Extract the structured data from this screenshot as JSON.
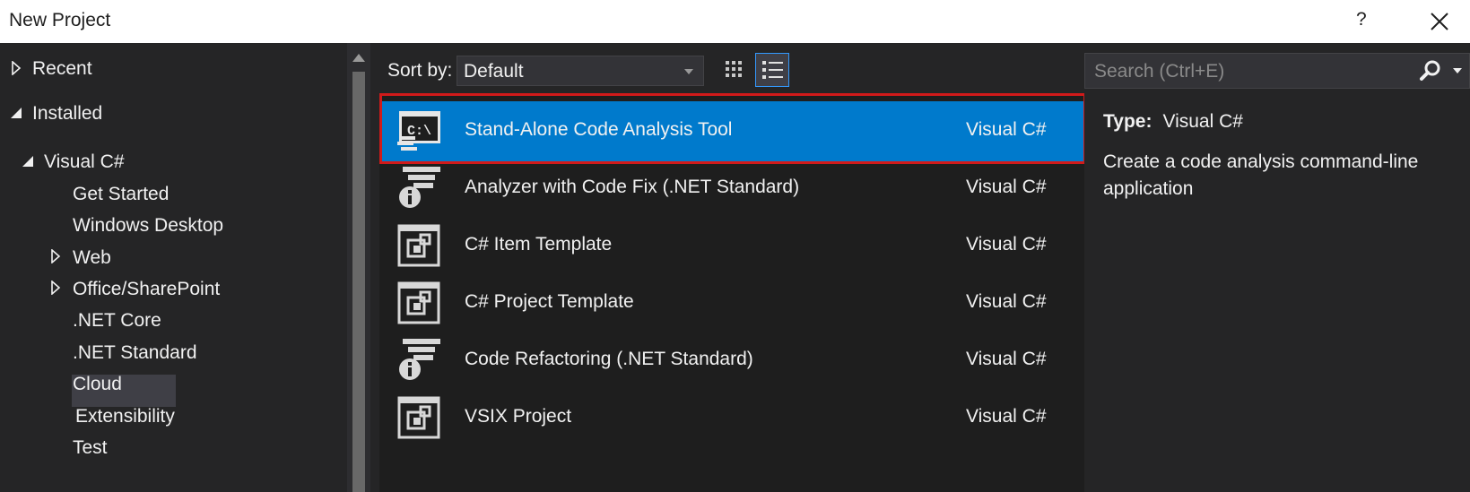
{
  "window": {
    "title": "New Project",
    "help_label": "?"
  },
  "tree": [
    {
      "label": "Recent",
      "indicator": "collapsed"
    },
    {
      "label": "Installed",
      "indicator": "expanded"
    },
    {
      "label": "Visual C#",
      "indicator": "expanded"
    },
    {
      "label": "Get Started",
      "indicator": "none"
    },
    {
      "label": "Windows Desktop",
      "indicator": "none"
    },
    {
      "label": "Web",
      "indicator": "collapsed"
    },
    {
      "label": "Office/SharePoint",
      "indicator": "collapsed"
    },
    {
      "label": ".NET Core",
      "indicator": "none"
    },
    {
      "label": ".NET Standard",
      "indicator": "none"
    },
    {
      "label": "Cloud",
      "indicator": "none"
    },
    {
      "label": "Extensibility",
      "indicator": "none",
      "selected": true
    },
    {
      "label": "Test",
      "indicator": "none"
    }
  ],
  "toolbar": {
    "sort_label": "Sort by:",
    "sort_value": "Default"
  },
  "templates": [
    {
      "name": "Stand-Alone Code Analysis Tool",
      "language": "Visual C#",
      "icon": "console-app-icon",
      "selected": true
    },
    {
      "name": "Analyzer with Code Fix (.NET Standard)",
      "language": "Visual C#",
      "icon": "analyzer-info-icon"
    },
    {
      "name": "C# Item Template",
      "language": "Visual C#",
      "icon": "template-icon"
    },
    {
      "name": "C# Project Template",
      "language": "Visual C#",
      "icon": "template-icon"
    },
    {
      "name": "Code Refactoring (.NET Standard)",
      "language": "Visual C#",
      "icon": "analyzer-info-icon"
    },
    {
      "name": "VSIX Project",
      "language": "Visual C#",
      "icon": "template-icon"
    }
  ],
  "search": {
    "placeholder": "Search (Ctrl+E)"
  },
  "details": {
    "type_label": "Type:",
    "type_value": "Visual C#",
    "description": "Create a code analysis command-line application"
  },
  "colors": {
    "selected_row": "#007acc",
    "highlight_border": "#d11a1a",
    "background": "#252526"
  }
}
